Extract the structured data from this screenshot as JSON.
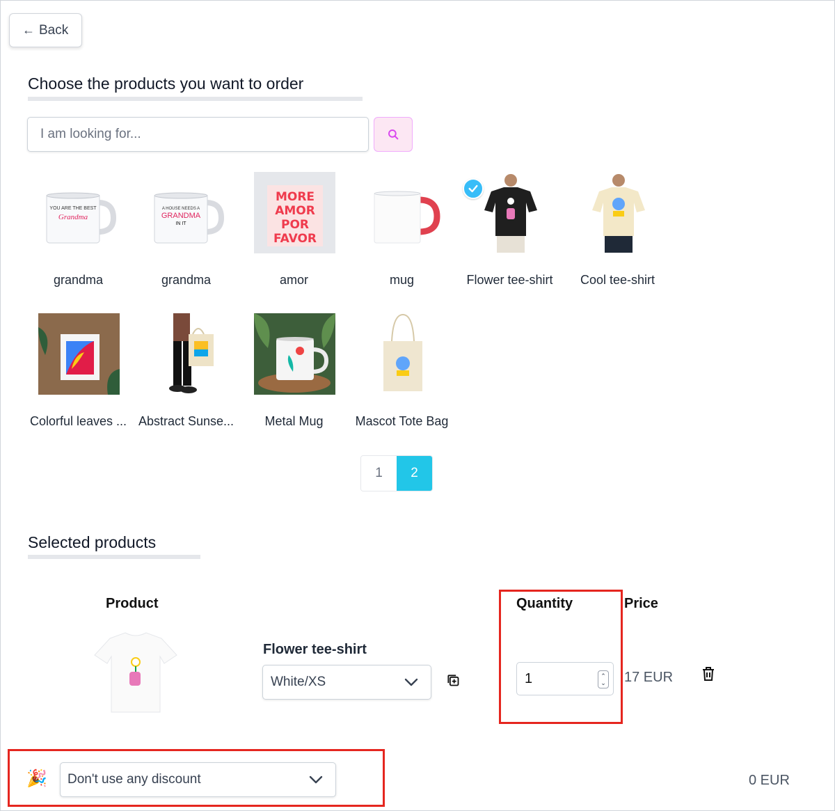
{
  "back_button": {
    "label": "Back",
    "icon": "arrow-left-icon"
  },
  "catalog": {
    "title": "Choose the products you want to order",
    "search": {
      "placeholder": "I am looking for...",
      "button_icon": "search-icon"
    },
    "products": [
      {
        "name": "grandma",
        "kind": "mug",
        "selected": false
      },
      {
        "name": "grandma",
        "kind": "mug",
        "selected": false
      },
      {
        "name": "amor",
        "kind": "poster",
        "selected": false
      },
      {
        "name": "mug",
        "kind": "mug",
        "selected": false
      },
      {
        "name": "Flower tee-shirt",
        "kind": "tee-shirt",
        "selected": true
      },
      {
        "name": "Cool tee-shirt",
        "kind": "tee-shirt",
        "selected": false
      },
      {
        "name": "Colorful leaves ...",
        "kind": "tote bag",
        "selected": false
      },
      {
        "name": "Abstract Sunse...",
        "kind": "tote bag",
        "selected": false
      },
      {
        "name": "Metal Mug",
        "kind": "mug",
        "selected": false
      },
      {
        "name": "Mascot Tote Bag",
        "kind": "tote bag",
        "selected": false
      }
    ],
    "pagination": {
      "pages": [
        "1",
        "2"
      ],
      "current": "2"
    }
  },
  "selected": {
    "title": "Selected products",
    "headers": {
      "product": "Product",
      "quantity": "Quantity",
      "price": "Price"
    },
    "items": [
      {
        "name": "Flower tee-shirt",
        "variant": "White/XS",
        "quantity": "1",
        "price": "17 EUR"
      }
    ]
  },
  "footer": {
    "discount": "Don't use any discount",
    "discount_icon": "party-popper-icon",
    "total": "0 EUR"
  },
  "colors": {
    "accent": "#22c6e8",
    "check": "#38bdf8",
    "search_button_bg": "#fce7f3",
    "highlight": "#e5261f"
  }
}
